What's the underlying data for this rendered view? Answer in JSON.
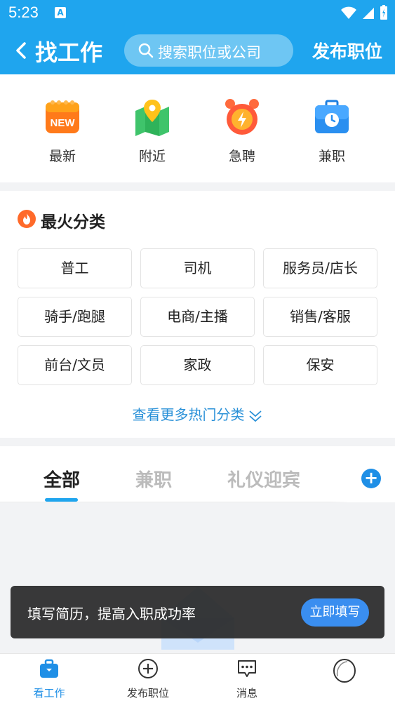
{
  "status": {
    "time": "5:23",
    "app_badge": "A"
  },
  "header": {
    "title": "找工作",
    "search_placeholder": "搜索职位或公司",
    "post_job": "发布职位"
  },
  "quick_entries": [
    {
      "label": "最新",
      "icon": "new-calendar-icon",
      "badge": "NEW"
    },
    {
      "label": "附近",
      "icon": "map-pin-icon"
    },
    {
      "label": "急聘",
      "icon": "alarm-clock-icon"
    },
    {
      "label": "兼职",
      "icon": "briefcase-clock-icon"
    }
  ],
  "categories": {
    "title": "最火分类",
    "items": [
      "普工",
      "司机",
      "服务员/店长",
      "骑手/跑腿",
      "电商/主播",
      "销售/客服",
      "前台/文员",
      "家政",
      "保安"
    ],
    "more": "查看更多热门分类"
  },
  "tabs": {
    "items": [
      "全部",
      "兼职",
      "礼仪迎宾"
    ],
    "active": "全部"
  },
  "toast": {
    "text": "填写简历，提高入职成功率",
    "button": "立即填写"
  },
  "bottom_nav": [
    {
      "label": "看工作",
      "icon": "briefcase-icon",
      "active": true
    },
    {
      "label": "发布职位",
      "icon": "plus-circle-icon",
      "active": false
    },
    {
      "label": "消息",
      "icon": "message-icon",
      "active": false
    },
    {
      "label": "",
      "icon": "avatar-icon",
      "active": false
    }
  ],
  "colors": {
    "brand": "#1fa5ee",
    "accent": "#1f8fe6",
    "link": "#2a91d8"
  }
}
